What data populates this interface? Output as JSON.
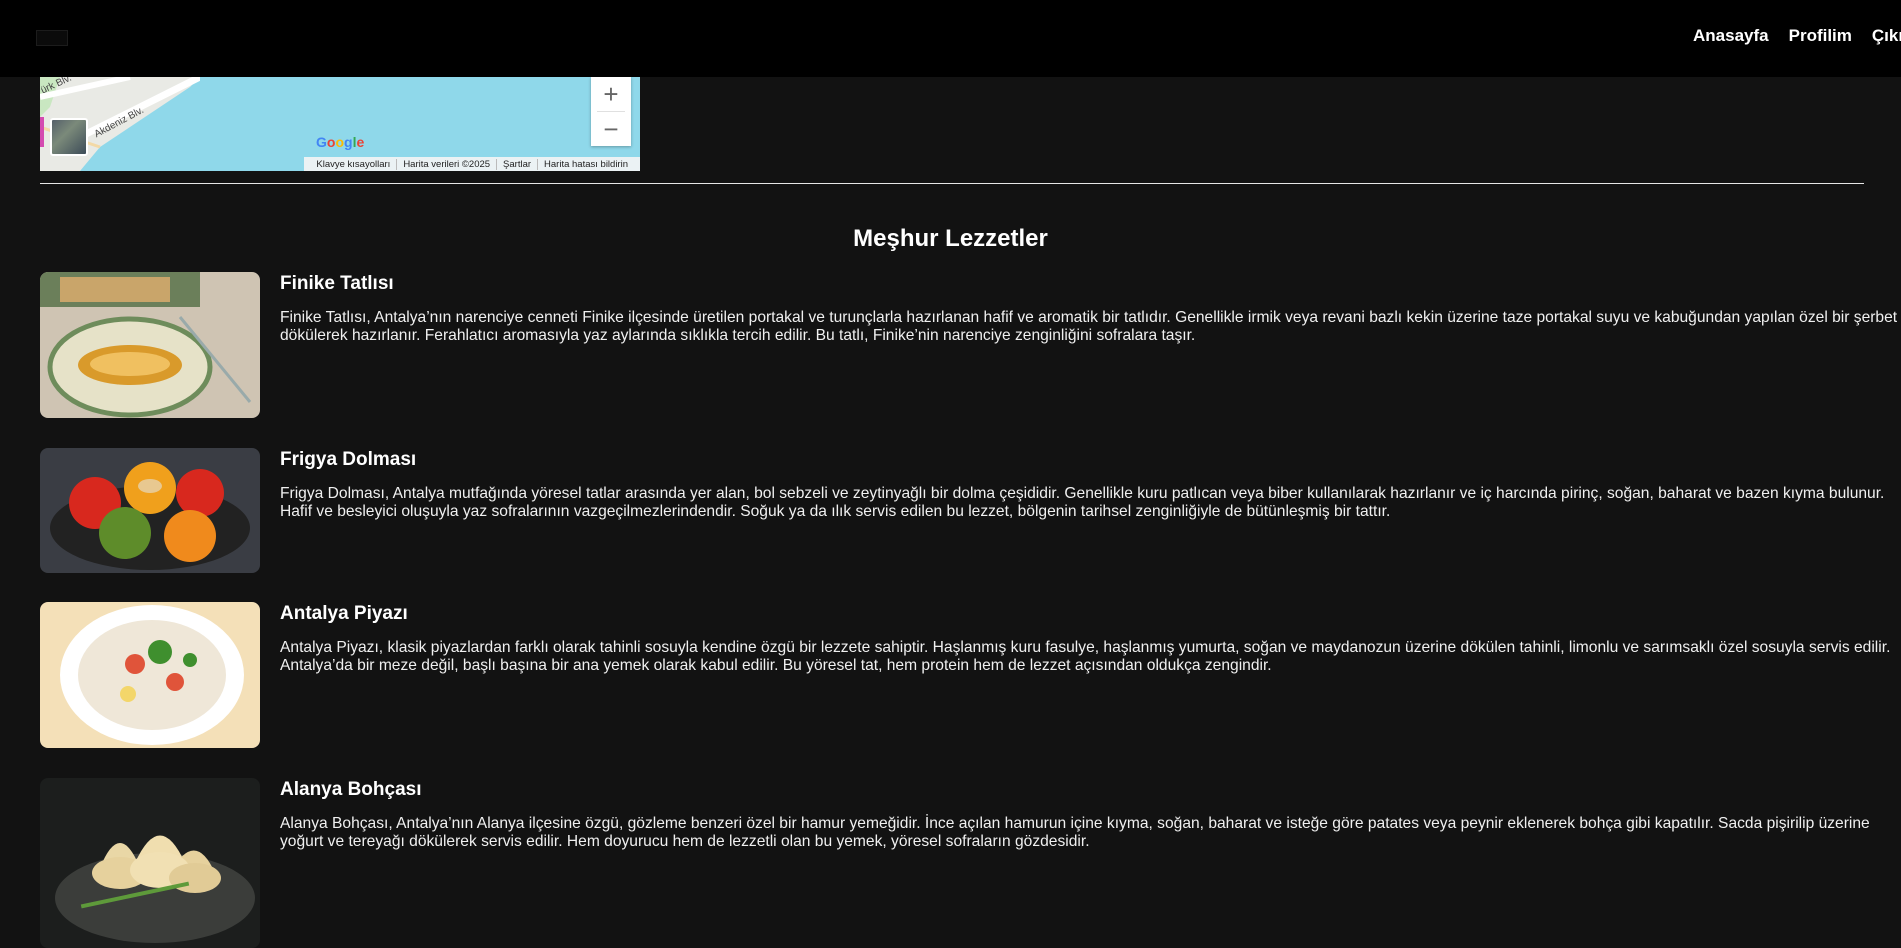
{
  "nav": {
    "links": [
      "Anasayfa",
      "Profilim",
      "Çıkış"
    ]
  },
  "map": {
    "street_label_1": "ürk Blv.",
    "street_label_2": "Akdeniz Blv.",
    "zoom_in": "+",
    "zoom_out": "−",
    "google_logo_letters": [
      "G",
      "o",
      "o",
      "g",
      "l",
      "e"
    ],
    "footer": [
      "Klavye kısayolları",
      "Harita verileri ©2025",
      "Şartlar",
      "Harita hatası bildirin"
    ]
  },
  "section": {
    "title": "Meşhur Lezzetler"
  },
  "foods": [
    {
      "name": "Finike Tatlısı",
      "description": "Finike Tatlısı, Antalya’nın narenciye cenneti Finike ilçesinde üretilen portakal ve turunçlarla hazırlanan hafif ve aromatik bir tatlıdır. Genellikle irmik veya revani bazlı kekin üzerine taze portakal suyu ve kabuğundan yapılan özel bir şerbet dökülerek hazırlanır. Ferahlatıcı aromasıyla yaz aylarında sıklıkla tercih edilir. Bu tatlı, Finike’nin narenciye zenginliğini sofralara taşır."
    },
    {
      "name": "Frigya Dolması",
      "description": "Frigya Dolması, Antalya mutfağında yöresel tatlar arasında yer alan, bol sebzeli ve zeytinyağlı bir dolma çeşididir. Genellikle kuru patlıcan veya biber kullanılarak hazırlanır ve iç harcında pirinç, soğan, baharat ve bazen kıyma bulunur. Hafif ve besleyici oluşuyla yaz sofralarının vazgeçilmezlerindendir. Soğuk ya da ılık servis edilen bu lezzet, bölgenin tarihsel zenginliğiyle de bütünleşmiş bir tattır."
    },
    {
      "name": "Antalya Piyazı",
      "description": "Antalya Piyazı, klasik piyazlardan farklı olarak tahinli sosuyla kendine özgü bir lezzete sahiptir. Haşlanmış kuru fasulye, haşlanmış yumurta, soğan ve maydanozun üzerine dökülen tahinli, limonlu ve sarımsaklı özel sosuyla servis edilir. Antalya’da bir meze değil, başlı başına bir ana yemek olarak kabul edilir. Bu yöresel tat, hem protein hem de lezzet açısından oldukça zengindir."
    },
    {
      "name": "Alanya Bohçası",
      "description": "Alanya Bohçası, Antalya’nın Alanya ilçesine özgü, gözleme benzeri özel bir hamur yemeğidir. İnce açılan hamurun içine kıyma, soğan, baharat ve isteğe göre patates veya peynir eklenerek bohça gibi kapatılır. Sacda pişirilip üzerine yoğurt ve tereyağı dökülerek servis edilir. Hem doyurucu hem de lezzetli olan bu yemek, yöresel sofraların gözdesidir."
    }
  ]
}
